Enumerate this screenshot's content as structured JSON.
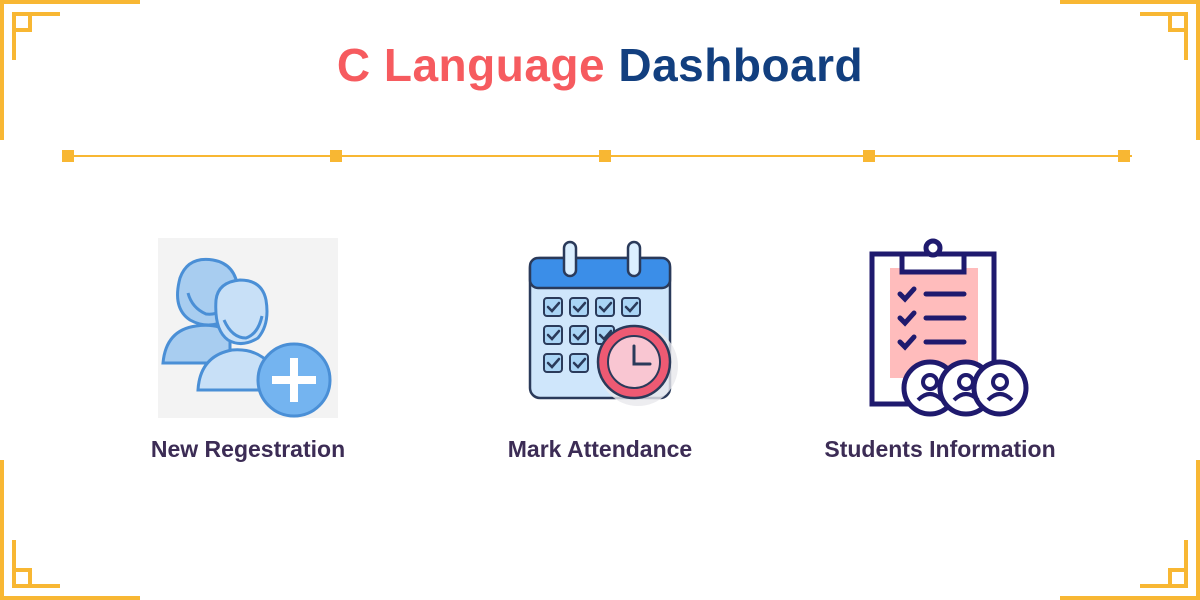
{
  "header": {
    "title_part1": "C Language",
    "title_part2": "Dashboard"
  },
  "colors": {
    "accent_red": "#f65b5f",
    "accent_navy": "#123f7f",
    "gold": "#f8b733",
    "label_text": "#3c2c55"
  },
  "menu": {
    "items": [
      {
        "label": "New Regestration",
        "icon": "user-add-icon"
      },
      {
        "label": "Mark Attendance",
        "icon": "calendar-clock-icon"
      },
      {
        "label": "Students Information",
        "icon": "clipboard-students-icon"
      }
    ]
  }
}
